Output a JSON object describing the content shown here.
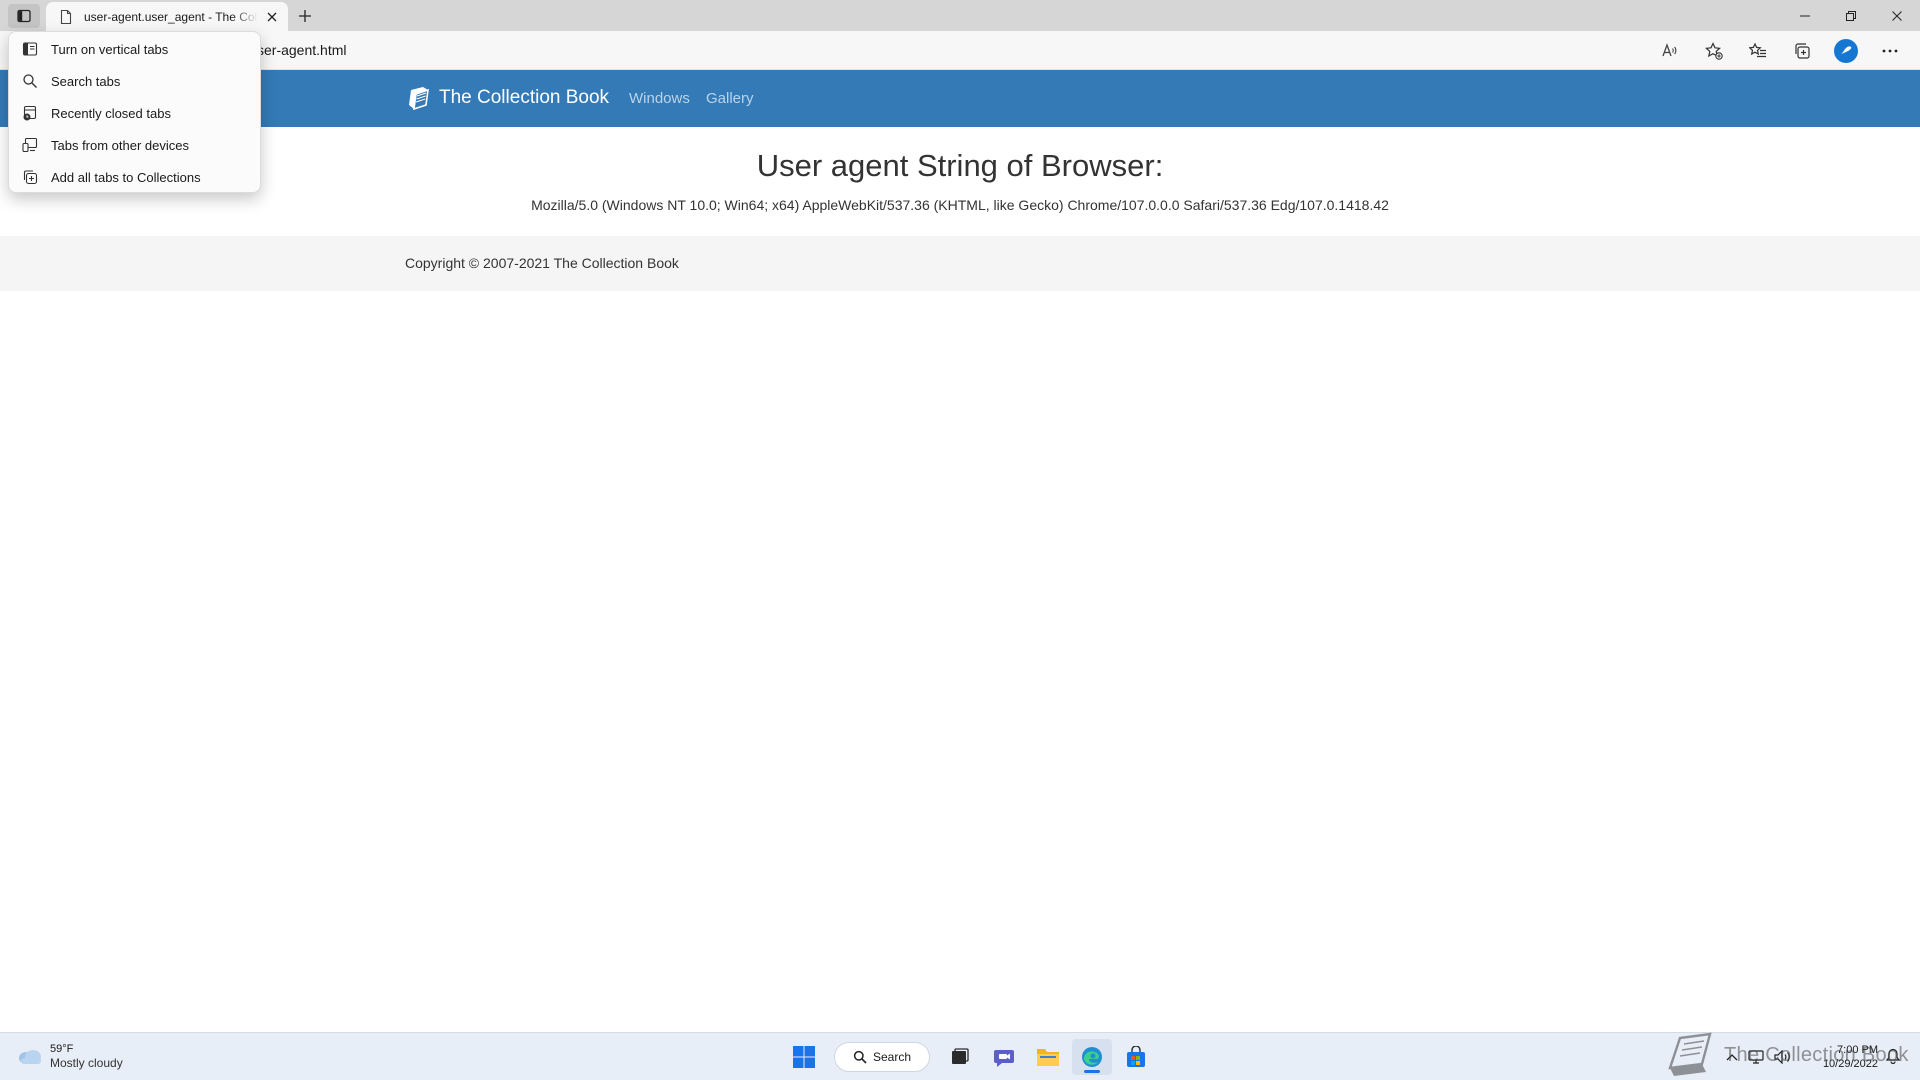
{
  "browser": {
    "tab": {
      "title": "user-agent.user_agent - The Collection Book",
      "favicon": "page-icon"
    },
    "address": "ser-agent.html",
    "toolbar_icons": [
      "read-aloud-icon",
      "favorite-star-icon",
      "favorites-icon",
      "collections-icon",
      "profile-icon",
      "more-icon"
    ]
  },
  "tab_menu": {
    "items": [
      {
        "label": "Turn on vertical tabs",
        "icon": "vertical-tabs-icon"
      },
      {
        "label": "Search tabs",
        "icon": "search-icon"
      },
      {
        "label": "Recently closed tabs",
        "icon": "recently-closed-icon"
      },
      {
        "label": "Tabs from other devices",
        "icon": "devices-icon"
      },
      {
        "label": "Add all tabs to Collections",
        "icon": "collections-icon"
      }
    ]
  },
  "site": {
    "brand": "The Collection Book",
    "nav": [
      "Windows",
      "Gallery"
    ],
    "heading": "User agent String of Browser:",
    "user_agent": "Mozilla/5.0 (Windows NT 10.0; Win64; x64) AppleWebKit/537.36 (KHTML, like Gecko) Chrome/107.0.0.0 Safari/537.36 Edg/107.0.1418.42",
    "copyright": "Copyright © 2007-2021 The Collection Book",
    "nav_color": "#337ab7"
  },
  "taskbar": {
    "weather": {
      "temp": "59°F",
      "desc": "Mostly cloudy"
    },
    "search_label": "Search",
    "clock": {
      "time": "7:00 PM",
      "date": "10/29/2022"
    },
    "watermark": "The Collection Book"
  }
}
